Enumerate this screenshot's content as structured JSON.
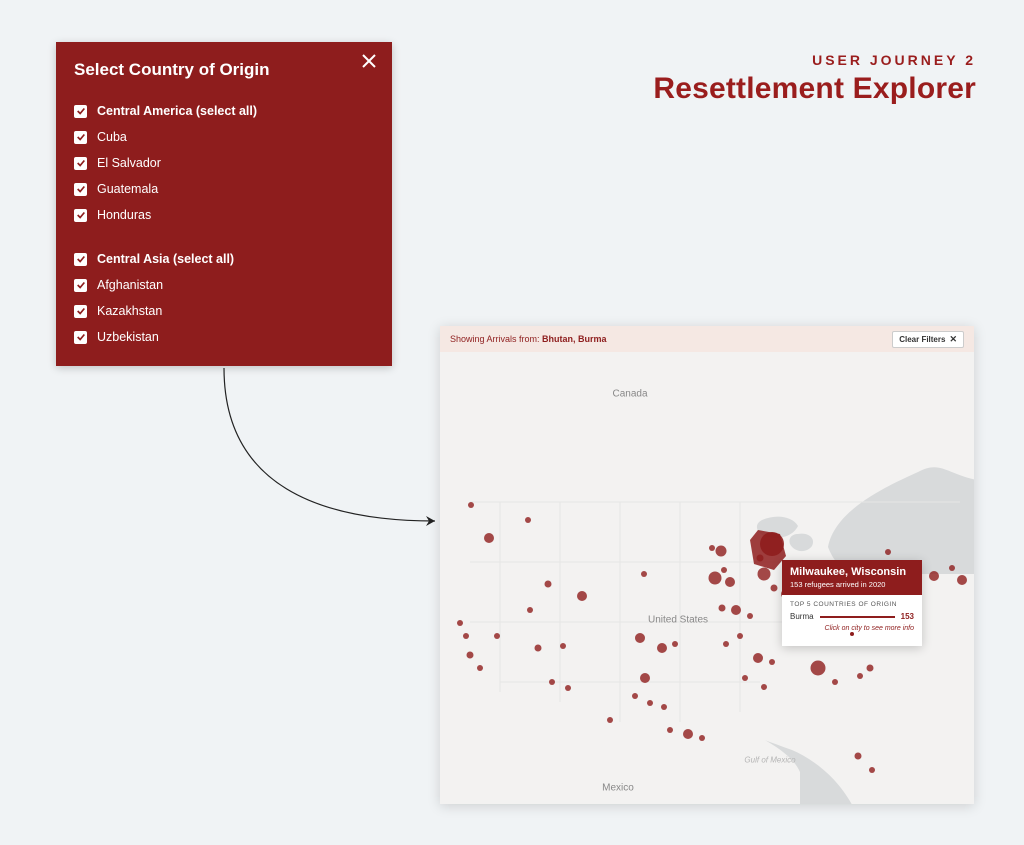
{
  "header": {
    "label": "USER JOURNEY 2",
    "title": "Resettlement Explorer"
  },
  "filter_panel": {
    "title": "Select Country of Origin",
    "groups": [
      {
        "header": "Central America (select all)",
        "items": [
          "Cuba",
          "El Salvador",
          "Guatemala",
          "Honduras"
        ]
      },
      {
        "header": "Central Asia (select all)",
        "items": [
          "Afghanistan",
          "Kazakhstan",
          "Uzbekistan"
        ]
      }
    ]
  },
  "map": {
    "topbar_prefix": "Showing Arrivals from: ",
    "topbar_filters": "Bhutan, Burma",
    "clear_filters_label": "Clear Filters",
    "tooltip": {
      "city": "Milwaukee, Wisconsin",
      "subtitle": "153 refugees arrived in 2020",
      "section_label": "TOP 5 COUNTRIES OF ORIGIN",
      "origin_name": "Burma",
      "origin_value": "153",
      "footer_text": "Click on city to see more info"
    },
    "labels": {
      "canada": "Canada",
      "united_states": "United States",
      "mexico": "Mexico",
      "gulf": "Gulf of Mexico"
    }
  }
}
